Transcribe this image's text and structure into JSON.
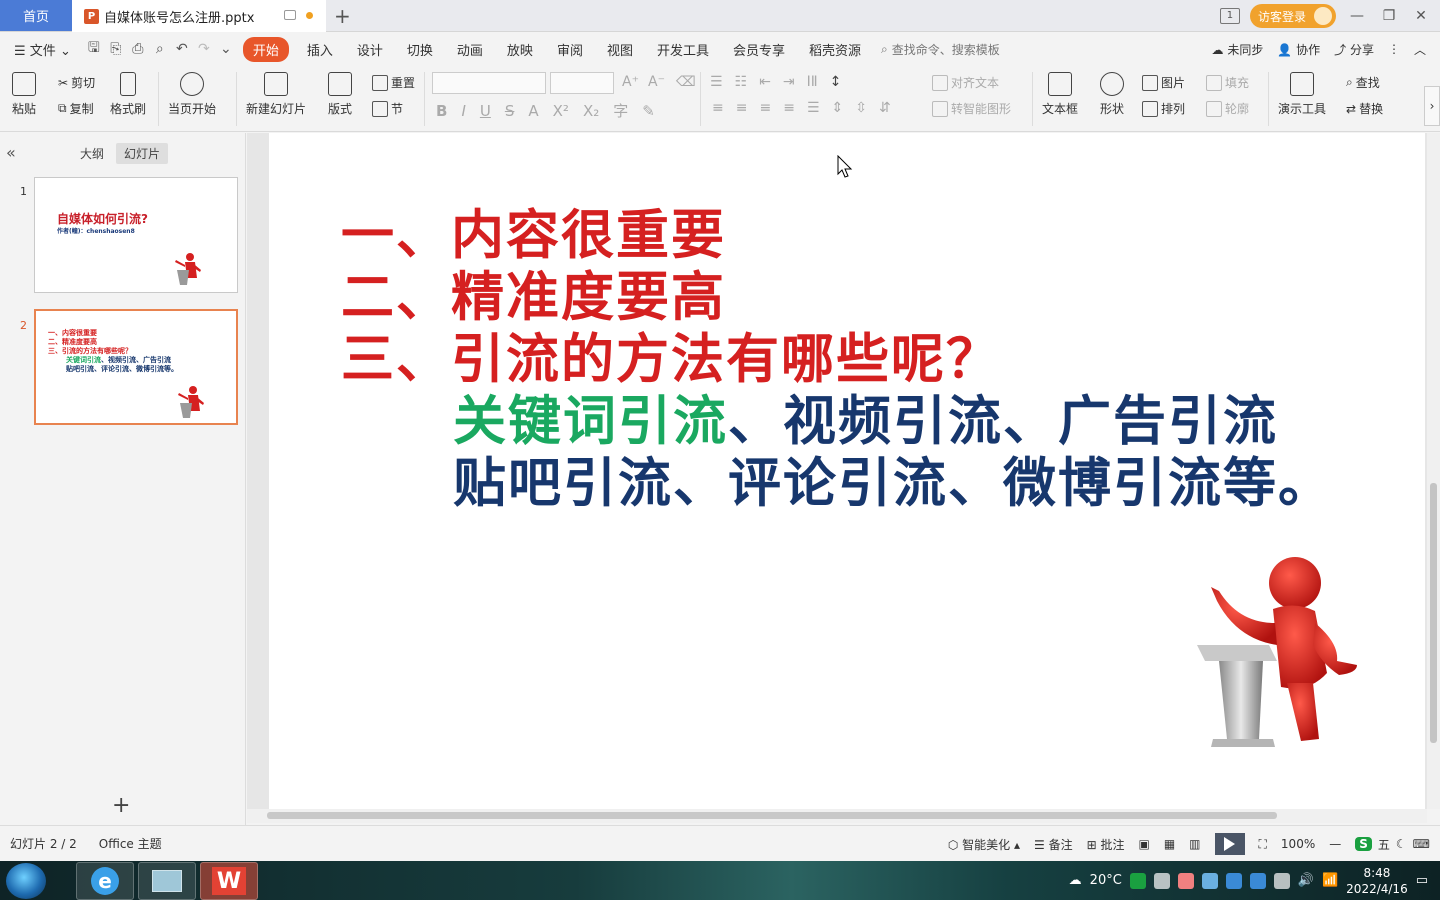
{
  "tabs": {
    "home": "首页",
    "document": "自媒体账号怎么注册.pptx",
    "ppt_badge": "P",
    "new_tab": "+"
  },
  "window": {
    "guest_login": "访客登录",
    "page_indicator": "1"
  },
  "menu": {
    "file": "文件",
    "items": [
      "开始",
      "插入",
      "设计",
      "切换",
      "动画",
      "放映",
      "审阅",
      "视图",
      "开发工具",
      "会员专享",
      "稻壳资源"
    ],
    "search_placeholder": "查找命令、搜索模板",
    "right": [
      "未同步",
      "协作",
      "分享"
    ]
  },
  "ribbon": {
    "paste": "粘贴",
    "cut": "剪切",
    "copy": "复制",
    "format_painter": "格式刷",
    "from_current": "当页开始",
    "new_slide": "新建幻灯片",
    "layout": "版式",
    "reset": "重置",
    "section": "节",
    "align_text": "对齐文本",
    "smartart": "转智能图形",
    "textbox": "文本框",
    "shapes": "形状",
    "picture": "图片",
    "arrange": "排列",
    "fill": "填充",
    "outline": "轮廓",
    "present_tools": "演示工具",
    "find": "查找",
    "replace": "替换"
  },
  "panel": {
    "outline_tab": "大纲",
    "slides_tab": "幻灯片",
    "slides": [
      {
        "num": "1",
        "title": "自媒体如何引流?",
        "author": "作者(幢)：chenshaosen8"
      },
      {
        "num": "2",
        "lines": [
          "一、内容很重要",
          "二、精准度要高",
          "三、引流的方法有哪些呢？"
        ],
        "green": "关键词引流",
        "line4_rest": "、视频引流、广告引流",
        "line5": "贴吧引流、评论引流、微博引流等。"
      }
    ]
  },
  "slide": {
    "line1": "一、内容很重要",
    "line2": "二、精准度要高",
    "line3": "三、引流的方法有哪些呢？",
    "line4_green": "关键词引流",
    "line4_rest": "、视频引流、广告引流",
    "line5": "贴吧引流、评论引流、微博引流等。"
  },
  "status": {
    "slide_count": "幻灯片 2 / 2",
    "theme": "Office 主题",
    "beautify": "智能美化",
    "notes": "备注",
    "comments": "批注",
    "zoom": "100%"
  },
  "taskbar": {
    "temperature": "20°C",
    "time": "8:48",
    "date": "2022/4/16",
    "ime": "五"
  },
  "colors": {
    "accent": "#e8562a",
    "slide_red": "#d52020",
    "slide_green": "#1aa860",
    "slide_navy": "#17376d",
    "home_tab": "#4b7bd6"
  }
}
